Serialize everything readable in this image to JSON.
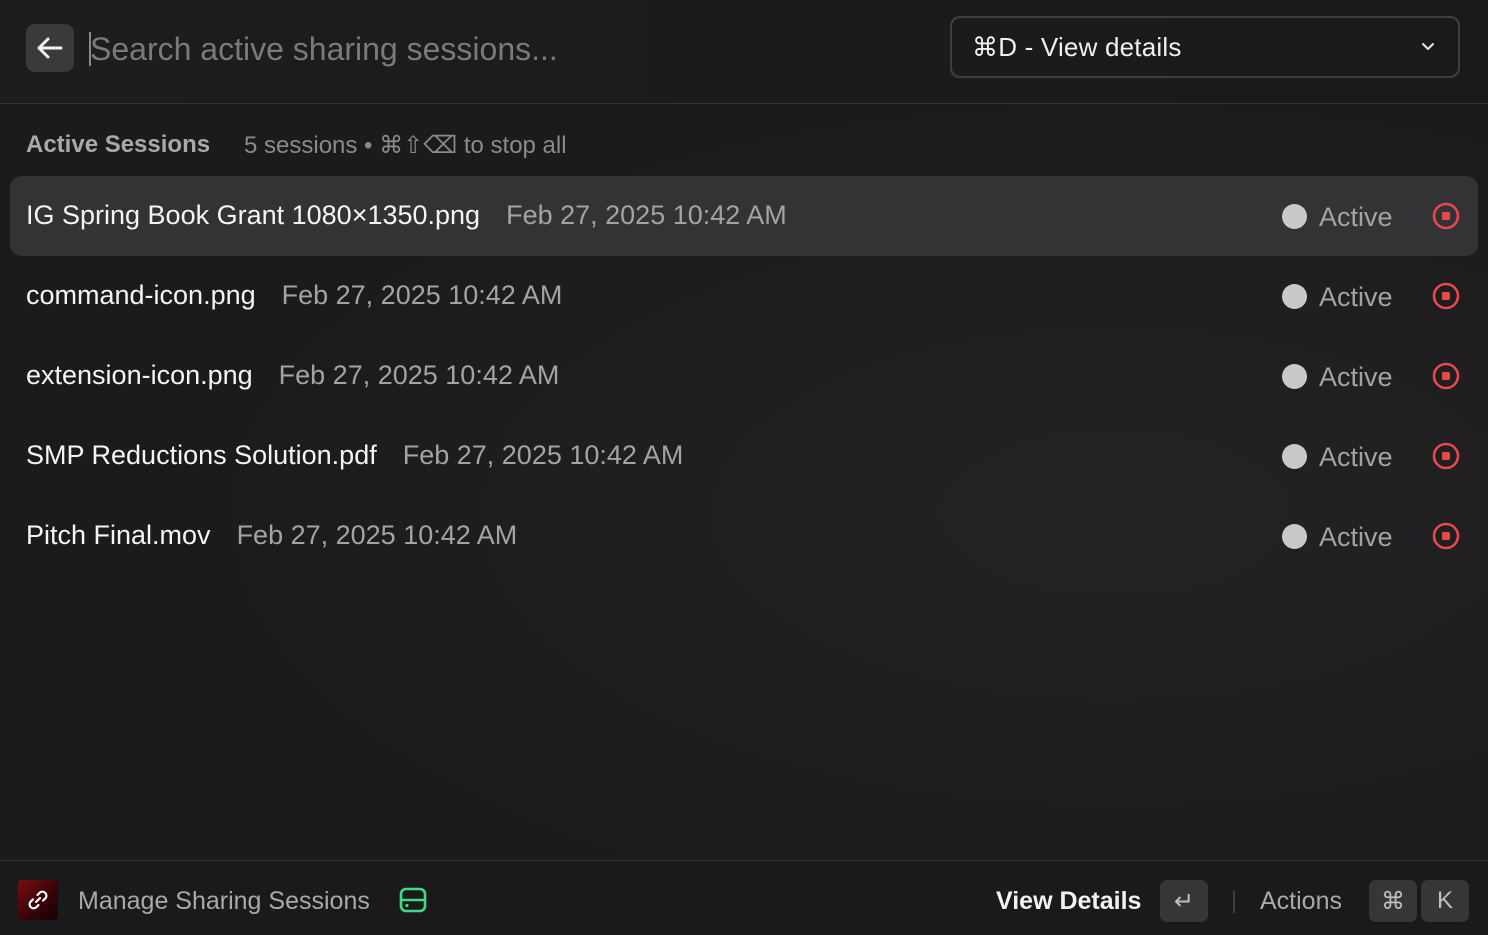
{
  "search": {
    "placeholder": "Search active sharing sessions...",
    "value": ""
  },
  "dropdown": {
    "selected": "⌘D - View details"
  },
  "section": {
    "title": "Active Sessions",
    "subtitle": "5 sessions • ⌘⇧⌫ to stop all"
  },
  "sessions": [
    {
      "name": "IG Spring Book Grant 1080×1350.png",
      "date": "Feb 27, 2025 10:42 AM",
      "status": "Active",
      "selected": true
    },
    {
      "name": "command-icon.png",
      "date": "Feb 27, 2025 10:42 AM",
      "status": "Active",
      "selected": false
    },
    {
      "name": "extension-icon.png",
      "date": "Feb 27, 2025 10:42 AM",
      "status": "Active",
      "selected": false
    },
    {
      "name": "SMP Reductions Solution.pdf",
      "date": "Feb 27, 2025 10:42 AM",
      "status": "Active",
      "selected": false
    },
    {
      "name": "Pitch Final.mov",
      "date": "Feb 27, 2025 10:42 AM",
      "status": "Active",
      "selected": false
    }
  ],
  "footer": {
    "title": "Manage Sharing Sessions",
    "primary_action": "View Details",
    "enter_key": "↵",
    "actions_label": "Actions",
    "cmd_key": "⌘",
    "k_key": "K"
  },
  "colors": {
    "stop_red": "#e5484d",
    "status_dot": "#c9c8cb",
    "drive_green": "#3ddc84"
  },
  "icons": {
    "back": "arrow-left-icon",
    "chevron": "chevron-down-icon",
    "status": "status-dot-icon",
    "stop": "stop-circle-icon",
    "app": "link-icon",
    "drive": "drive-icon"
  }
}
